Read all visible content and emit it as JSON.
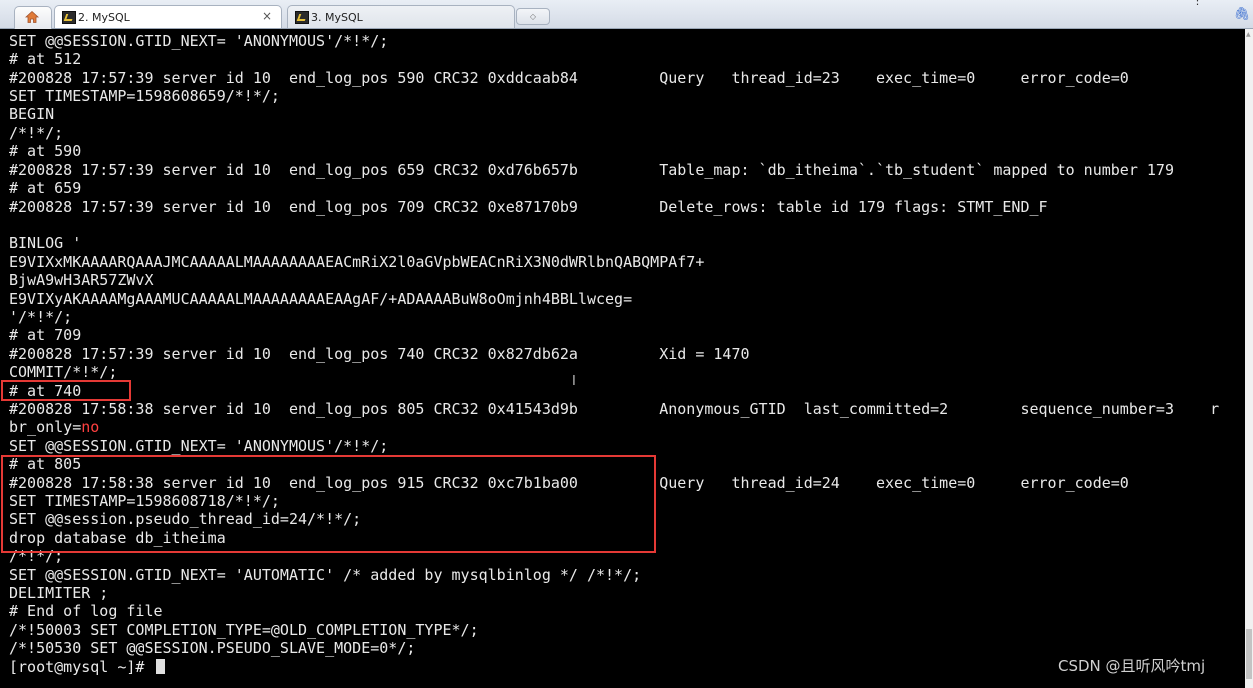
{
  "tabs": [
    {
      "label": "2. MySQL",
      "close": "×",
      "active": true
    },
    {
      "label": "3. MySQL",
      "active": false
    }
  ],
  "terminal": {
    "lines": [
      "SET @@SESSION.GTID_NEXT= 'ANONYMOUS'/*!*/;",
      "# at 512",
      "#200828 17:57:39 server id 10  end_log_pos 590 CRC32 0xddcaab84         Query   thread_id=23    exec_time=0     error_code=0",
      "SET TIMESTAMP=1598608659/*!*/;",
      "BEGIN",
      "/*!*/;",
      "# at 590",
      "#200828 17:57:39 server id 10  end_log_pos 659 CRC32 0xd76b657b         Table_map: `db_itheima`.`tb_student` mapped to number 179",
      "# at 659",
      "#200828 17:57:39 server id 10  end_log_pos 709 CRC32 0xe87170b9         Delete_rows: table id 179 flags: STMT_END_F",
      "",
      "BINLOG '",
      "E9VIXxMKAAAARQAAAJMCAAAAALMAAAAAAAAEACmRiX2l0aGVpbWEACnRiX3N0dWRlbnQABQMPAf7+",
      "BjwA9wH3AR57ZWvX",
      "E9VIXyAKAAAAMgAAAMUCAAAAALMAAAAAAAAEAAgAF/+ADAAAABuW8oOmjnh4BBLlwceg=",
      "'/*!*/;",
      "# at 709",
      "#200828 17:57:39 server id 10  end_log_pos 740 CRC32 0x827db62a         Xid = 1470",
      "COMMIT/*!*/;",
      "# at 740",
      "#200828 17:58:38 server id 10  end_log_pos 805 CRC32 0x41543d9b         Anonymous_GTID  last_committed=2        sequence_number=3    r",
      "",
      "SET @@SESSION.GTID_NEXT= 'ANONYMOUS'/*!*/;",
      "# at 805",
      "#200828 17:58:38 server id 10  end_log_pos 915 CRC32 0xc7b1ba00         Query   thread_id=24    exec_time=0     error_code=0",
      "SET TIMESTAMP=1598608718/*!*/;",
      "SET @@session.pseudo_thread_id=24/*!*/;",
      "drop database db_itheima",
      "/*!*/;",
      "SET @@SESSION.GTID_NEXT= 'AUTOMATIC' /* added by mysqlbinlog */ /*!*/;",
      "DELIMITER ;",
      "# End of log file",
      "/*!50003 SET COMPLETION_TYPE=@OLD_COMPLETION_TYPE*/;",
      "/*!50530 SET @@SESSION.PSEUDO_SLAVE_MODE=0*/;",
      "[root@mysql ~]# "
    ],
    "br_only_prefix": "br_only=",
    "br_only_value": "no"
  },
  "watermark": "CSDN @且听风吟tmj",
  "colors": {
    "terminal_bg": "#000000",
    "terminal_fg": "#e9e9e9",
    "highlight": "#e53935",
    "keyword_red": "#ff4040"
  }
}
